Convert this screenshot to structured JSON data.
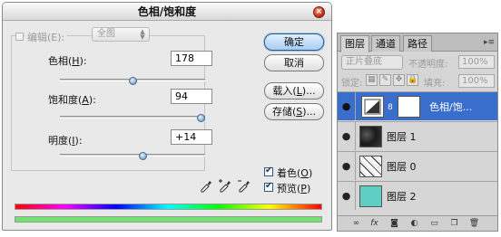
{
  "dialog": {
    "title": "色相/饱和度",
    "edit": {
      "label": "编辑(E):",
      "value": "全图"
    },
    "hue": {
      "label_pre": "色相(",
      "key": "H",
      "label_post": "):",
      "value": "178",
      "level": 0.5
    },
    "saturation": {
      "label_pre": "饱和度(",
      "key": "A",
      "label_post": "):",
      "value": "94",
      "level": 0.97
    },
    "lightness": {
      "label_pre": "明度(",
      "key": "I",
      "label_post": "):",
      "value": "+14",
      "level": 0.57
    },
    "buttons": {
      "ok": "确定",
      "cancel": "取消",
      "load_pre": "载入(",
      "load_key": "L",
      "load_post": ")...",
      "save_pre": "存储(",
      "save_key": "S",
      "save_post": ")..."
    },
    "colorize": {
      "label_pre": "着色(",
      "key": "O",
      "label_post": ")",
      "checked": true
    },
    "preview": {
      "label_pre": "预览(",
      "key": "P",
      "label_post": ")",
      "checked": true
    }
  },
  "layers_panel": {
    "tabs": [
      "图层",
      "通道",
      "路径"
    ],
    "blend_mode": "正片叠底",
    "opacity_label": "不透明度:",
    "opacity": "100%",
    "lock_label": "锁定:",
    "fill_label": "填充:",
    "fill": "100%",
    "layers": [
      {
        "name": "色相/饱...",
        "selected": true,
        "thumb_color": "#f4f4f4"
      },
      {
        "name": "图层 1",
        "selected": false,
        "thumb_color": "#2a2a2a"
      },
      {
        "name": "图层 0",
        "selected": false,
        "thumb_color": "#ececec"
      },
      {
        "name": "图层 2",
        "selected": false,
        "thumb_color": "#5fcfc4"
      }
    ]
  },
  "colors": {
    "selected_layer": "#3a6ecc",
    "teal_layer": "#5fcfc4",
    "spectrum_bottom": "#6fe36f"
  }
}
